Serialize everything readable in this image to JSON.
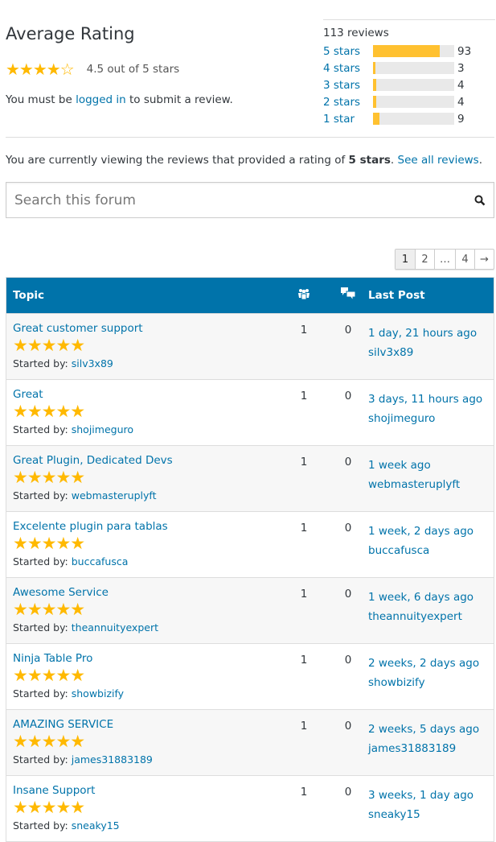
{
  "rating": {
    "title": "Average Rating",
    "stars": "★★★★☆",
    "value": "4.5 out of 5 stars",
    "login_pre": "You must be ",
    "login_link": "logged in",
    "login_post": " to submit a review."
  },
  "histogram": {
    "total": "113 reviews",
    "rows": [
      {
        "label": "5 stars",
        "count": "93",
        "pct": 82.3
      },
      {
        "label": "4 stars",
        "count": "3",
        "pct": 2.7
      },
      {
        "label": "3 stars",
        "count": "4",
        "pct": 3.5
      },
      {
        "label": "2 stars",
        "count": "4",
        "pct": 3.5
      },
      {
        "label": "1 star",
        "count": "9",
        "pct": 8
      }
    ]
  },
  "viewing": {
    "pre": "You are currently viewing the reviews that provided a rating of ",
    "bold": "5 stars",
    "post": ". ",
    "link": "See all reviews",
    "end": "."
  },
  "search": {
    "placeholder": "Search this forum",
    "icon": "search-icon"
  },
  "pagination": [
    "1",
    "2",
    "…",
    "4",
    "→"
  ],
  "table": {
    "headers": {
      "topic": "Topic",
      "voices_icon": "people-icon",
      "replies_icon": "speech-bubbles-icon",
      "last_post": "Last Post"
    },
    "started_by": "Started by: ",
    "rows": [
      {
        "title": "Great customer support",
        "stars": "★★★★★",
        "author": "silv3x89",
        "voices": "1",
        "replies": "0",
        "time": "1 day, 21 hours ago",
        "last": "silv3x89"
      },
      {
        "title": "Great",
        "stars": "★★★★★",
        "author": "shojimeguro",
        "voices": "1",
        "replies": "0",
        "time": "3 days, 11 hours ago",
        "last": "shojimeguro"
      },
      {
        "title": "Great Plugin, Dedicated Devs",
        "stars": "★★★★★",
        "author": "webmasteruplyft",
        "voices": "1",
        "replies": "0",
        "time": "1 week ago",
        "last": "webmasteruplyft"
      },
      {
        "title": "Excelente plugin para tablas",
        "stars": "★★★★★",
        "author": "buccafusca",
        "voices": "1",
        "replies": "0",
        "time": "1 week, 2 days ago",
        "last": "buccafusca"
      },
      {
        "title": "Awesome Service",
        "stars": "★★★★★",
        "author": "theannuityexpert",
        "voices": "1",
        "replies": "0",
        "time": "1 week, 6 days ago",
        "last": "theannuityexpert"
      },
      {
        "title": "Ninja Table Pro",
        "stars": "★★★★★",
        "author": "showbizify",
        "voices": "1",
        "replies": "0",
        "time": "2 weeks, 2 days ago",
        "last": "showbizify"
      },
      {
        "title": "AMAZING SERVICE",
        "stars": "★★★★★",
        "author": "james31883189",
        "voices": "1",
        "replies": "0",
        "time": "2 weeks, 5 days ago",
        "last": "james31883189"
      },
      {
        "title": "Insane Support",
        "stars": "★★★★★",
        "author": "sneaky15",
        "voices": "1",
        "replies": "0",
        "time": "3 weeks, 1 day ago",
        "last": "sneaky15"
      }
    ]
  },
  "colors": {
    "link": "#0073aa",
    "header": "#0073aa",
    "star": "#ffb900",
    "bar": "#ffc130"
  }
}
